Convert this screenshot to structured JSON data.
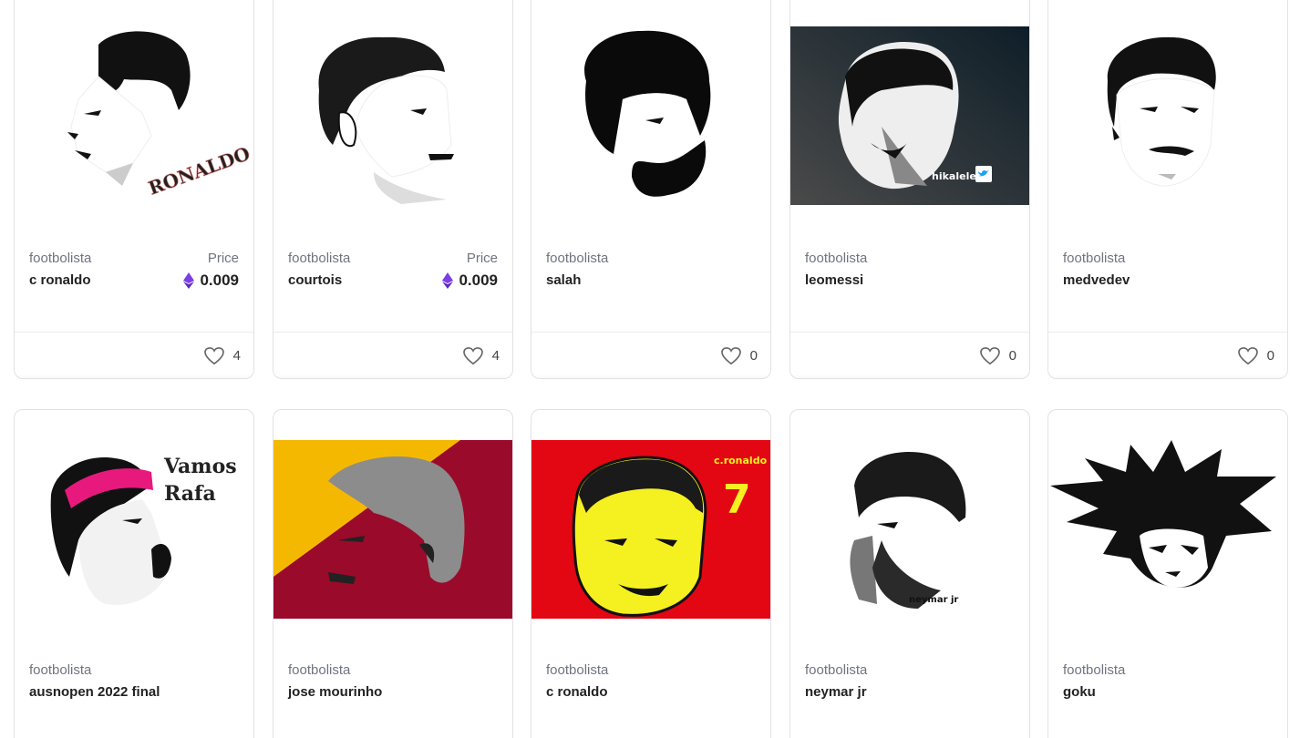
{
  "cards": [
    {
      "creator": "footbolista",
      "title": "c ronaldo",
      "price_label": "Price",
      "price": "0.009",
      "likes": "4",
      "art_text": "RONALDO",
      "image_icon": "ronaldo-portrait-icon"
    },
    {
      "creator": "footbolista",
      "title": "courtois",
      "price_label": "Price",
      "price": "0.009",
      "likes": "4",
      "image_icon": "courtois-portrait-icon"
    },
    {
      "creator": "footbolista",
      "title": "salah",
      "likes": "0",
      "image_icon": "salah-portrait-icon"
    },
    {
      "creator": "footbolista",
      "title": "leomessi",
      "likes": "0",
      "art_text": "hikalele",
      "image_icon": "messi-portrait-icon"
    },
    {
      "creator": "footbolista",
      "title": "medvedev",
      "likes": "0",
      "image_icon": "medvedev-portrait-icon"
    },
    {
      "creator": "footbolista",
      "title": "ausnopen 2022 final",
      "art_text": "Vamos\nRafa",
      "art_text_line1": "Vamos",
      "art_text_line2": "Rafa",
      "image_icon": "nadal-portrait-icon"
    },
    {
      "creator": "footbolista",
      "title": "jose mourinho",
      "image_icon": "mourinho-portrait-icon"
    },
    {
      "creator": "footbolista",
      "title": "c ronaldo",
      "art_text_line1": "c.ronaldo",
      "art_text_line2": "7",
      "image_icon": "ronaldo-yellow-portrait-icon"
    },
    {
      "creator": "footbolista",
      "title": "neymar jr",
      "art_text": "neymar jr",
      "image_icon": "neymar-portrait-icon"
    },
    {
      "creator": "footbolista",
      "title": "goku",
      "image_icon": "goku-portrait-icon"
    }
  ],
  "icons": {
    "like": "heart-icon",
    "currency": "ethereum-icon"
  },
  "colors": {
    "eth": "#7b3fe4",
    "mourinho_yellow": "#f5b800",
    "mourinho_red": "#9a0a2a",
    "ronaldo_red": "#e30613",
    "ronaldo_yellow": "#f5f020",
    "nadal_pink": "#e8197d",
    "messi_bg": "#1f2f3a"
  }
}
